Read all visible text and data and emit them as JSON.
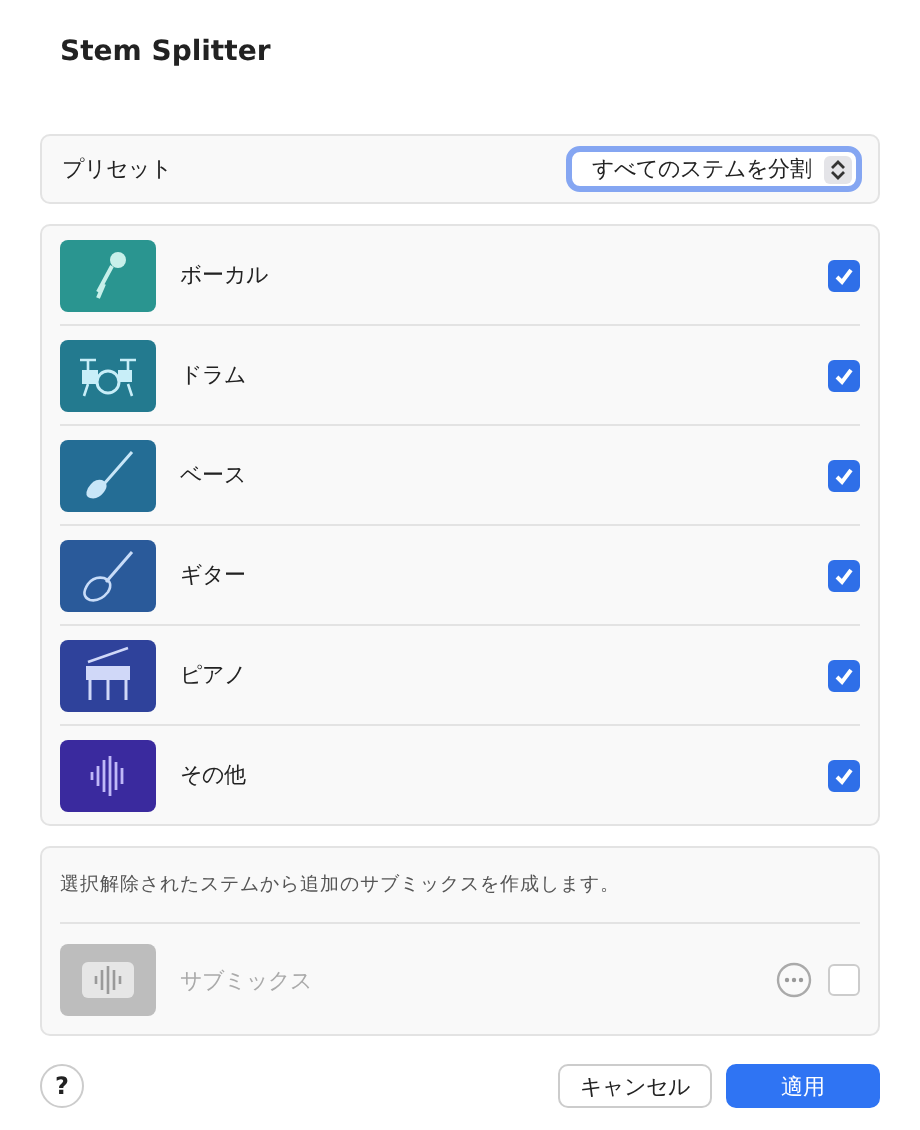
{
  "window": {
    "title": "Stem Splitter"
  },
  "preset": {
    "label": "プリセット",
    "value": "すべてのステムを分割"
  },
  "stems": [
    {
      "kind": "vocals",
      "name": "ボーカル",
      "color": "#2a9590",
      "checked": true
    },
    {
      "kind": "drums",
      "name": "ドラム",
      "color": "#237a8f",
      "checked": true
    },
    {
      "kind": "bass",
      "name": "ベース",
      "color": "#246d95",
      "checked": true
    },
    {
      "kind": "guitar",
      "name": "ギター",
      "color": "#2a5a9a",
      "checked": true
    },
    {
      "kind": "piano",
      "name": "ピアノ",
      "color": "#2f429b",
      "checked": true
    },
    {
      "kind": "other",
      "name": "その他",
      "color": "#3a2a9e",
      "checked": true
    }
  ],
  "submix": {
    "description": "選択解除されたステムから追加のサブミックスを作成します。",
    "name": "サブミックス",
    "disabled": true,
    "checked": false
  },
  "buttons": {
    "help": "?",
    "cancel": "キャンセル",
    "apply": "適用"
  }
}
